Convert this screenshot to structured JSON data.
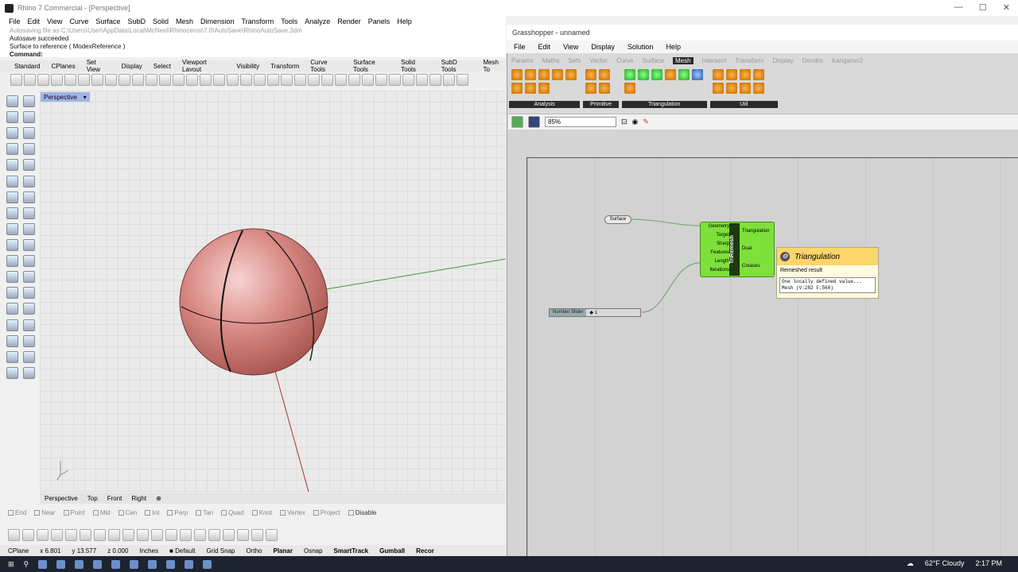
{
  "rhino": {
    "title": "Rhino 7 Commercial - [Perspective]",
    "menu": [
      "File",
      "Edit",
      "View",
      "Curve",
      "Surface",
      "SubD",
      "Solid",
      "Mesh",
      "Dimension",
      "Transform",
      "Tools",
      "Analyze",
      "Render",
      "Panels",
      "Help"
    ],
    "history": [
      "Autosaving file as C:\\Users\\User\\AppData\\Local\\McNeel\\Rhinoceros\\7.0\\AutoSave\\RhinoAutoSave.3dm",
      "Autosave succeeded",
      "Surface to reference ( ModexReference )"
    ],
    "command_label": "Command:",
    "tabs": [
      "Standard",
      "CPlanes",
      "Set View",
      "Display",
      "Select",
      "Viewport Layout",
      "Visibility",
      "Transform",
      "Curve Tools",
      "Surface Tools",
      "Solid Tools",
      "SubD Tools",
      "Mesh To"
    ],
    "viewport_label": "Perspective",
    "viewport_tabs": [
      "Perspective",
      "Top",
      "Front",
      "Right"
    ],
    "osnaps": [
      "End",
      "Near",
      "Point",
      "Mid",
      "Cen",
      "Int",
      "Perp",
      "Tan",
      "Quad",
      "Knot",
      "Vertex",
      "Project",
      "Disable"
    ],
    "status": {
      "cplane": "CPlane",
      "x": "x 6.801",
      "y": "y 13.577",
      "z": "z 0.000",
      "units": "Inches",
      "layer": "Default",
      "grid_snap": "Grid Snap",
      "ortho": "Ortho",
      "planar": "Planar",
      "osnap": "Osnap",
      "smarttrack": "SmartTrack",
      "gumball": "Gumball",
      "record": "Recor"
    }
  },
  "gh": {
    "title": "Grasshopper - unnamed",
    "menu": [
      "File",
      "Edit",
      "View",
      "Display",
      "Solution",
      "Help"
    ],
    "tabs": [
      "Params",
      "Maths",
      "Sets",
      "Vector",
      "Curve",
      "Surface",
      "Mesh",
      "Intersect",
      "Transform",
      "Display",
      "Dendro",
      "Kangaroo2"
    ],
    "ribbon_groups": [
      "Analysis",
      "Primitive",
      "Triangulation",
      "Util"
    ],
    "zoom": "85%",
    "surface_param": "Surface",
    "slider_label": "Number Slider",
    "slider_value": "◆ 1",
    "component": {
      "name": "TriRemesh",
      "inputs": [
        "Geometry",
        "Target",
        "Sharp",
        "Features",
        "Length",
        "Iterations"
      ],
      "outputs": [
        "Triangulation",
        "Dual",
        "Creases"
      ]
    },
    "tooltip": {
      "title": "Triangulation",
      "desc": "Remeshed result",
      "value_line1": "One locally defined value...",
      "value_line2": "Mesh (V:282 F:560)"
    }
  },
  "taskbar": {
    "weather": "62°F Cloudy",
    "time": "2:17 PM"
  }
}
